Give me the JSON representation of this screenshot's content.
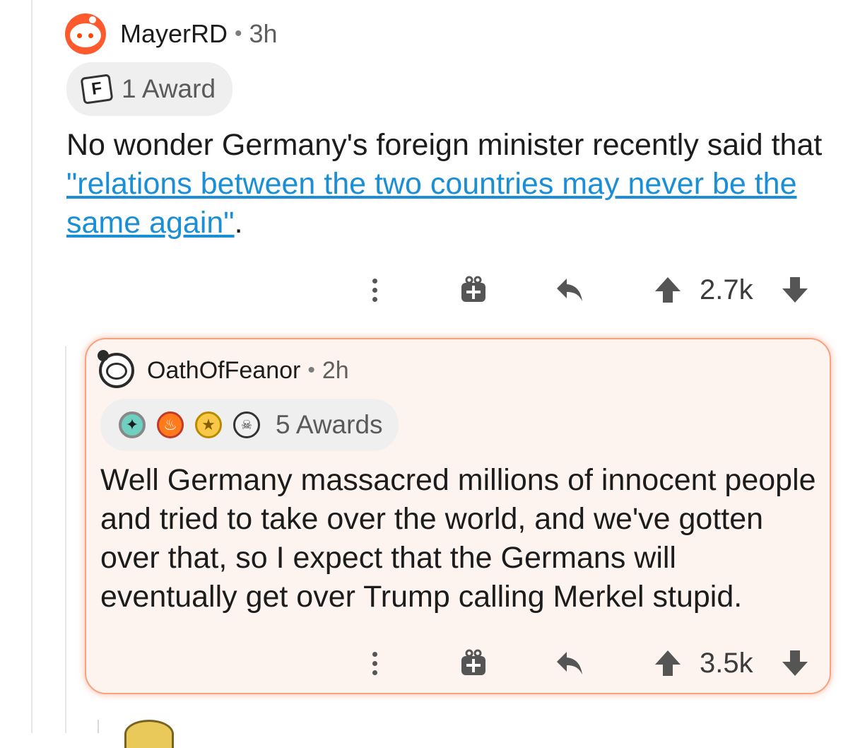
{
  "comment": {
    "username": "MayerRD",
    "time": "3h",
    "award_text": "1 Award",
    "body_prefix": "No wonder Germany's foreign minister recently said that ",
    "link_text": "\"relations between the two countries may never be the same again\"",
    "body_suffix": ".",
    "score": "2.7k"
  },
  "reply": {
    "username": "OathOfFeanor",
    "time": "2h",
    "award_text": "5 Awards",
    "body": "Well Germany massacred millions of innocent people and tried to take over the world, and we've gotten over that, so I expect that the Germans will eventually get over Trump calling Merkel stupid.",
    "score": "3.5k"
  },
  "separator": "•",
  "icons": {
    "more": "more-vertical-icon",
    "gift": "gift-icon",
    "reply": "reply-icon",
    "upvote": "upvote-icon",
    "downvote": "downvote-icon"
  },
  "colors": {
    "link": "#1a8fd6",
    "highlight_bg": "#fef4ef",
    "highlight_border": "#f8a27e",
    "reddit_orange": "#ff4500"
  }
}
